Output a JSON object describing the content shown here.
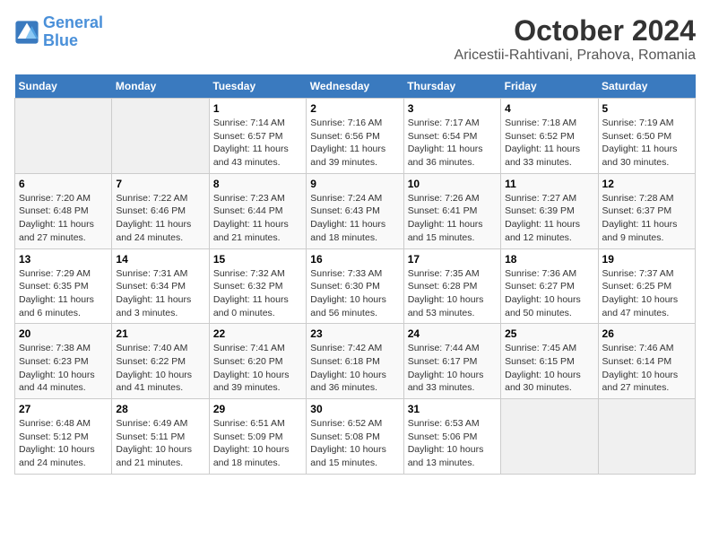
{
  "logo": {
    "line1": "General",
    "line2": "Blue"
  },
  "title": "October 2024",
  "subtitle": "Aricestii-Rahtivani, Prahova, Romania",
  "headers": [
    "Sunday",
    "Monday",
    "Tuesday",
    "Wednesday",
    "Thursday",
    "Friday",
    "Saturday"
  ],
  "weeks": [
    [
      {
        "day": "",
        "info": ""
      },
      {
        "day": "",
        "info": ""
      },
      {
        "day": "1",
        "info": "Sunrise: 7:14 AM\nSunset: 6:57 PM\nDaylight: 11 hours and 43 minutes."
      },
      {
        "day": "2",
        "info": "Sunrise: 7:16 AM\nSunset: 6:56 PM\nDaylight: 11 hours and 39 minutes."
      },
      {
        "day": "3",
        "info": "Sunrise: 7:17 AM\nSunset: 6:54 PM\nDaylight: 11 hours and 36 minutes."
      },
      {
        "day": "4",
        "info": "Sunrise: 7:18 AM\nSunset: 6:52 PM\nDaylight: 11 hours and 33 minutes."
      },
      {
        "day": "5",
        "info": "Sunrise: 7:19 AM\nSunset: 6:50 PM\nDaylight: 11 hours and 30 minutes."
      }
    ],
    [
      {
        "day": "6",
        "info": "Sunrise: 7:20 AM\nSunset: 6:48 PM\nDaylight: 11 hours and 27 minutes."
      },
      {
        "day": "7",
        "info": "Sunrise: 7:22 AM\nSunset: 6:46 PM\nDaylight: 11 hours and 24 minutes."
      },
      {
        "day": "8",
        "info": "Sunrise: 7:23 AM\nSunset: 6:44 PM\nDaylight: 11 hours and 21 minutes."
      },
      {
        "day": "9",
        "info": "Sunrise: 7:24 AM\nSunset: 6:43 PM\nDaylight: 11 hours and 18 minutes."
      },
      {
        "day": "10",
        "info": "Sunrise: 7:26 AM\nSunset: 6:41 PM\nDaylight: 11 hours and 15 minutes."
      },
      {
        "day": "11",
        "info": "Sunrise: 7:27 AM\nSunset: 6:39 PM\nDaylight: 11 hours and 12 minutes."
      },
      {
        "day": "12",
        "info": "Sunrise: 7:28 AM\nSunset: 6:37 PM\nDaylight: 11 hours and 9 minutes."
      }
    ],
    [
      {
        "day": "13",
        "info": "Sunrise: 7:29 AM\nSunset: 6:35 PM\nDaylight: 11 hours and 6 minutes."
      },
      {
        "day": "14",
        "info": "Sunrise: 7:31 AM\nSunset: 6:34 PM\nDaylight: 11 hours and 3 minutes."
      },
      {
        "day": "15",
        "info": "Sunrise: 7:32 AM\nSunset: 6:32 PM\nDaylight: 11 hours and 0 minutes."
      },
      {
        "day": "16",
        "info": "Sunrise: 7:33 AM\nSunset: 6:30 PM\nDaylight: 10 hours and 56 minutes."
      },
      {
        "day": "17",
        "info": "Sunrise: 7:35 AM\nSunset: 6:28 PM\nDaylight: 10 hours and 53 minutes."
      },
      {
        "day": "18",
        "info": "Sunrise: 7:36 AM\nSunset: 6:27 PM\nDaylight: 10 hours and 50 minutes."
      },
      {
        "day": "19",
        "info": "Sunrise: 7:37 AM\nSunset: 6:25 PM\nDaylight: 10 hours and 47 minutes."
      }
    ],
    [
      {
        "day": "20",
        "info": "Sunrise: 7:38 AM\nSunset: 6:23 PM\nDaylight: 10 hours and 44 minutes."
      },
      {
        "day": "21",
        "info": "Sunrise: 7:40 AM\nSunset: 6:22 PM\nDaylight: 10 hours and 41 minutes."
      },
      {
        "day": "22",
        "info": "Sunrise: 7:41 AM\nSunset: 6:20 PM\nDaylight: 10 hours and 39 minutes."
      },
      {
        "day": "23",
        "info": "Sunrise: 7:42 AM\nSunset: 6:18 PM\nDaylight: 10 hours and 36 minutes."
      },
      {
        "day": "24",
        "info": "Sunrise: 7:44 AM\nSunset: 6:17 PM\nDaylight: 10 hours and 33 minutes."
      },
      {
        "day": "25",
        "info": "Sunrise: 7:45 AM\nSunset: 6:15 PM\nDaylight: 10 hours and 30 minutes."
      },
      {
        "day": "26",
        "info": "Sunrise: 7:46 AM\nSunset: 6:14 PM\nDaylight: 10 hours and 27 minutes."
      }
    ],
    [
      {
        "day": "27",
        "info": "Sunrise: 6:48 AM\nSunset: 5:12 PM\nDaylight: 10 hours and 24 minutes."
      },
      {
        "day": "28",
        "info": "Sunrise: 6:49 AM\nSunset: 5:11 PM\nDaylight: 10 hours and 21 minutes."
      },
      {
        "day": "29",
        "info": "Sunrise: 6:51 AM\nSunset: 5:09 PM\nDaylight: 10 hours and 18 minutes."
      },
      {
        "day": "30",
        "info": "Sunrise: 6:52 AM\nSunset: 5:08 PM\nDaylight: 10 hours and 15 minutes."
      },
      {
        "day": "31",
        "info": "Sunrise: 6:53 AM\nSunset: 5:06 PM\nDaylight: 10 hours and 13 minutes."
      },
      {
        "day": "",
        "info": ""
      },
      {
        "day": "",
        "info": ""
      }
    ]
  ]
}
